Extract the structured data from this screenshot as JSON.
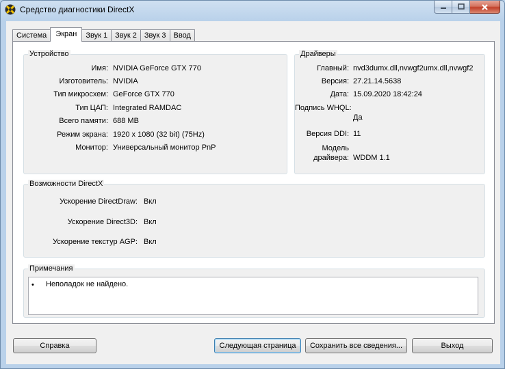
{
  "window": {
    "title": "Средство диагностики DirectX"
  },
  "tabs": [
    {
      "label": "Система"
    },
    {
      "label": "Экран"
    },
    {
      "label": "Звук 1"
    },
    {
      "label": "Звук 2"
    },
    {
      "label": "Звук 3"
    },
    {
      "label": "Ввод"
    }
  ],
  "active_tab": "Экран",
  "device": {
    "title": "Устройство",
    "rows": [
      {
        "label": "Имя:",
        "value": "NVIDIA GeForce GTX 770"
      },
      {
        "label": "Изготовитель:",
        "value": "NVIDIA"
      },
      {
        "label": "Тип микросхем:",
        "value": "GeForce GTX 770"
      },
      {
        "label": "Тип ЦАП:",
        "value": "Integrated RAMDAC"
      },
      {
        "label": "Всего памяти:",
        "value": "688 MB"
      },
      {
        "label": "Режим экрана:",
        "value": "1920 x 1080 (32 bit) (75Hz)"
      },
      {
        "label": "Монитор:",
        "value": "Универсальный монитор PnP"
      }
    ]
  },
  "drivers": {
    "title": "Драйверы",
    "main_label": "Главный:",
    "main_value": "nvd3dumx.dll,nvwgf2umx.dll,nvwgf2",
    "version_label": "Версия:",
    "version_value": "27.21.14.5638",
    "date_label": "Дата:",
    "date_value": "15.09.2020 18:42:24",
    "whql_label": "Подпись WHQL:",
    "whql_value": "Да",
    "ddi_label": "Версия DDI:",
    "ddi_value": "11",
    "model_label_1": "Модель",
    "model_label_2": "драйвера:",
    "model_value": "WDDM 1.1"
  },
  "features": {
    "title": "Возможности DirectX",
    "rows": [
      {
        "label": "Ускорение DirectDraw:",
        "value": "Вкл"
      },
      {
        "label": "Ускорение Direct3D:",
        "value": "Вкл"
      },
      {
        "label": "Ускорение текстур AGP:",
        "value": "Вкл"
      }
    ]
  },
  "notes": {
    "title": "Примечания",
    "bullet": "•",
    "text": "Неполадок не найдено."
  },
  "buttons": {
    "help": "Справка",
    "next_page": "Следующая страница",
    "save_all": "Сохранить все сведения...",
    "exit": "Выход"
  }
}
